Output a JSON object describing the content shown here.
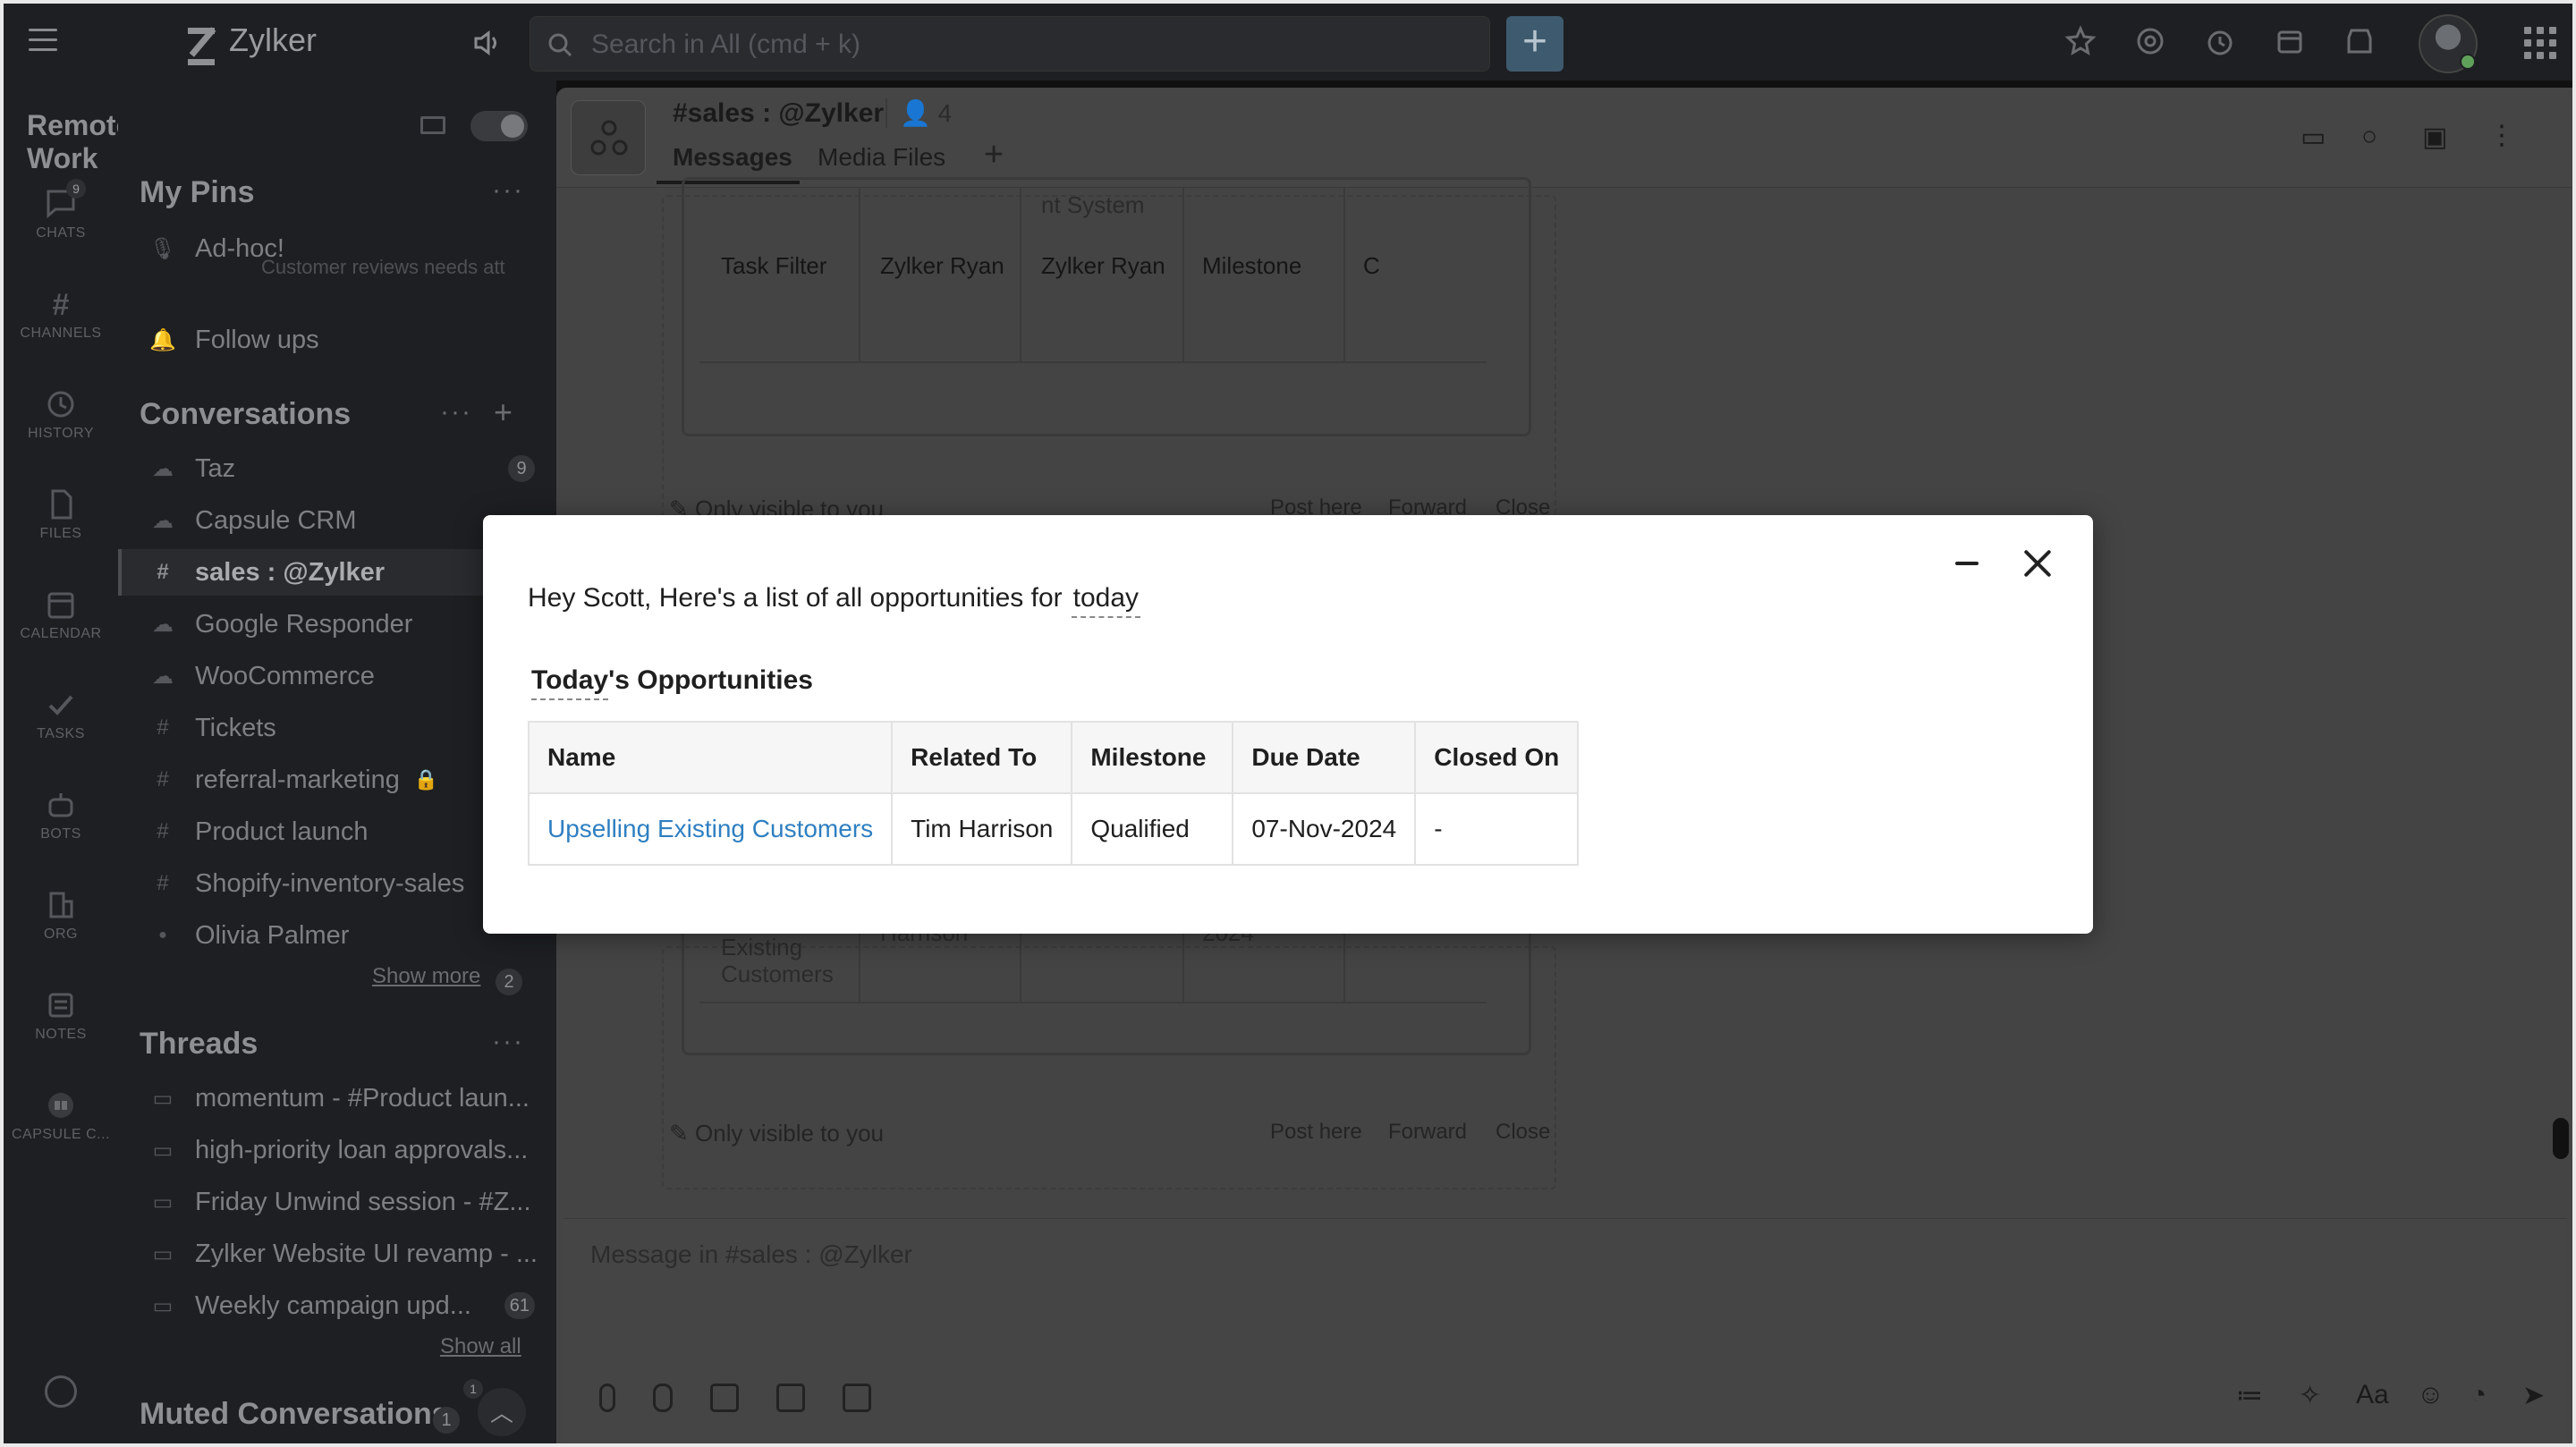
{
  "app": {
    "name": "Zylker"
  },
  "search": {
    "placeholder": "Search in All (cmd + k)"
  },
  "workspace": {
    "name": "Remote Work"
  },
  "rail": [
    {
      "label": "CHATS",
      "badge": "9",
      "icon": "chat-icon"
    },
    {
      "label": "CHANNELS",
      "icon": "hash-icon"
    },
    {
      "label": "HISTORY",
      "icon": "history-icon"
    },
    {
      "label": "FILES",
      "icon": "file-icon"
    },
    {
      "label": "CALENDAR",
      "icon": "calendar-icon"
    },
    {
      "label": "TASKS",
      "icon": "check-icon"
    },
    {
      "label": "BOTS",
      "icon": "bot-icon"
    },
    {
      "label": "ORG",
      "icon": "org-icon"
    },
    {
      "label": "NOTES",
      "icon": "notes-icon"
    },
    {
      "label": "CAPSULE C...",
      "icon": "capsule-icon"
    }
  ],
  "pins": {
    "title": "My Pins",
    "items": [
      {
        "label": "Ad-hoc!",
        "sub": "Customer reviews needs att"
      },
      {
        "label": "Follow ups"
      }
    ]
  },
  "conversations": {
    "title": "Conversations",
    "items": [
      {
        "icon": "☁",
        "label": "Taz",
        "count": "9"
      },
      {
        "icon": "☁",
        "label": "Capsule CRM"
      },
      {
        "icon": "#",
        "label": "sales : @Zylker",
        "active": true
      },
      {
        "icon": "☁",
        "label": "Google Responder"
      },
      {
        "icon": "☁",
        "label": "WooCommerce"
      },
      {
        "icon": "#",
        "label": "Tickets"
      },
      {
        "icon": "#",
        "label": "referral-marketing"
      },
      {
        "icon": "#",
        "label": "Product launch"
      },
      {
        "icon": "#",
        "label": "Shopify-inventory-sales"
      },
      {
        "icon": "●",
        "label": "Olivia Palmer"
      }
    ],
    "show_more": "Show more",
    "show_more_count": "2"
  },
  "threads": {
    "title": "Threads",
    "items": [
      {
        "label": "momentum - #Product laun..."
      },
      {
        "label": "high-priority loan approvals..."
      },
      {
        "label": "Friday Unwind session - #Z..."
      },
      {
        "label": "Zylker Website UI revamp - ..."
      },
      {
        "label": "Weekly campaign upd...",
        "count": "61"
      }
    ],
    "show_all": "Show all"
  },
  "muted": {
    "title": "Muted Conversations",
    "count": "1",
    "badge": "1"
  },
  "channel": {
    "title": "#sales : @Zylker",
    "members": "4",
    "tabs": [
      "Messages",
      "Media Files"
    ]
  },
  "background": {
    "frag_text": "nt System",
    "row": [
      "Task Filter",
      "Zylker Ryan",
      "Zylker Ryan",
      "Milestone",
      "C"
    ],
    "lower_row": [
      "Existing",
      "Customers",
      "Harrison",
      "2024"
    ],
    "visibility": "Only visible to you",
    "actions": [
      "Post here",
      "Forward",
      "Close"
    ]
  },
  "composer": {
    "placeholder": "Message in #sales : @Zylker",
    "format_label": "Aa"
  },
  "modal": {
    "greeting": "Hey Scott, Here's a list of all opportunities for",
    "keyword": "today",
    "heading_keyword": "Today",
    "heading_rest": "'s Opportunities",
    "columns": [
      "Name",
      "Related To",
      "Milestone",
      "Due Date",
      "Closed On"
    ],
    "rows": [
      [
        "Upselling Existing Customers",
        "Tim Harrison",
        "Qualified",
        "07-Nov-2024",
        "-"
      ]
    ]
  }
}
